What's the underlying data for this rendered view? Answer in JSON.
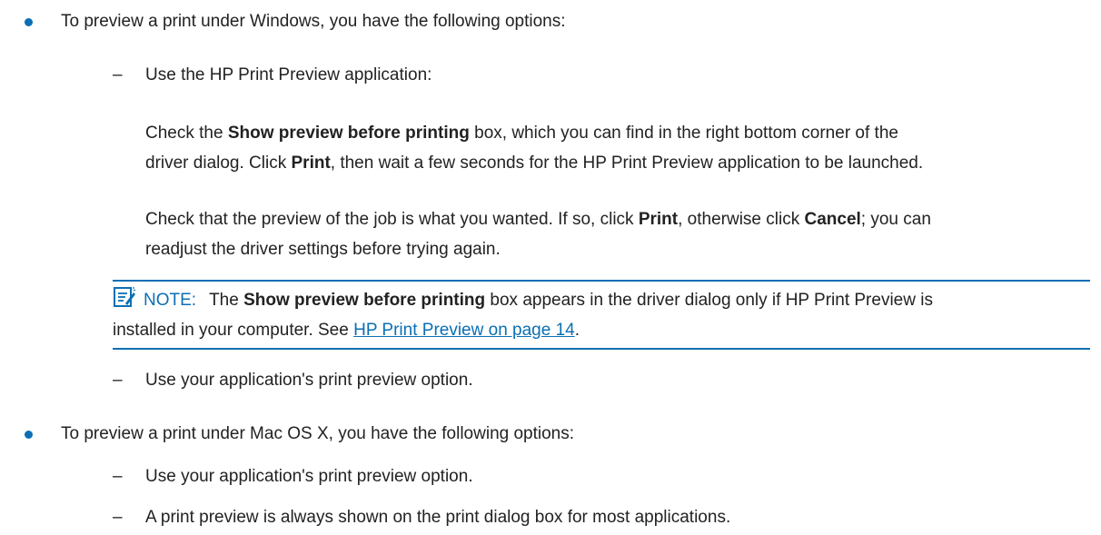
{
  "accent_color": "#0b6fb4",
  "items": {
    "windows_intro": "To preview a print under Windows, you have the following options:",
    "hp_preview_app": "Use the HP Print Preview application:",
    "p1": {
      "a": "Check the ",
      "b": "Show preview before printing",
      "c": " box, which you can find in the right bottom corner of the",
      "line2a": "driver dialog. Click ",
      "line2b": "Print",
      "line2c": ", then wait a few seconds for the HP Print Preview application to be launched."
    },
    "p2": {
      "a": "Check that the preview of the job is what you wanted. If so, click ",
      "b": "Print",
      "c": ", otherwise click ",
      "d": "Cancel",
      "e": "; you can",
      "line2": "readjust the driver settings before trying again."
    },
    "note": {
      "icon": "note-icon",
      "label": "NOTE:",
      "a": "The ",
      "b": "Show preview before printing",
      "c": " box appears in the driver dialog only if HP Print Preview is",
      "line2a": "installed in your computer. See ",
      "link": "HP Print Preview on page 14",
      "line2b": "."
    },
    "app_option_win": "Use your application's print preview option.",
    "mac_intro": "To preview a print under Mac OS X, you have the following options:",
    "app_option_mac": "Use your application's print preview option.",
    "always_shown": "A print preview is always shown on the print dialog box for most applications."
  }
}
